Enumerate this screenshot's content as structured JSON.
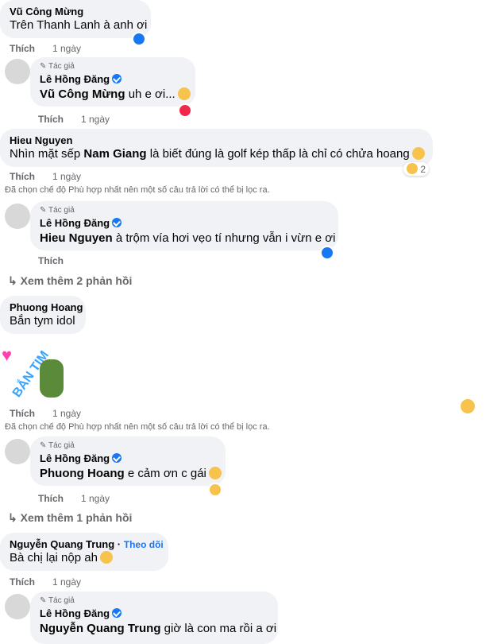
{
  "like_label": "Thích",
  "filter_note": "Đã chọn chế độ Phù hợp nhất nên một số câu trả lời có thể bị lọc ra.",
  "author_badge": "Tác giả",
  "comments": [
    {
      "name": "Vũ Công Mừng",
      "text": "Trên Thanh Lanh à anh ơi",
      "time": "1 ngày"
    },
    {
      "name": "Lê Hồng Đăng",
      "mention": "Vũ Công Mừng",
      "text": "uh e ơi...",
      "time": "1 ngày"
    },
    {
      "name": "Hieu Nguyen",
      "text_pre": "Nhìn mặt sếp",
      "mention": "Nam Giang",
      "text_post": "là biết đúng là golf kép thấp là chỉ có chửa hoang",
      "time": "1 ngày",
      "reaction_count": "2"
    },
    {
      "name": "Lê Hồng Đăng",
      "mention": "Hieu Nguyen",
      "text": "à trộm vía hơi vẹo tí nhưng vẫn i vừn e ơi",
      "time": ""
    },
    {
      "name": "Phuong Hoang",
      "text": "Bắn tym idol",
      "time": "1 ngày",
      "sticker": "BẮN TIM"
    },
    {
      "name": "Lê Hồng Đăng",
      "mention": "Phuong Hoang",
      "text": "e cảm ơn c gái",
      "time": "1 ngày"
    },
    {
      "name": "Nguyễn Quang Trung",
      "follow": "Theo dõi",
      "text": "Bà chị lại nộp ah",
      "time": "1 ngày"
    },
    {
      "name": "Lê Hồng Đăng",
      "mention": "Nguyễn Quang Trung",
      "text": "giờ là con ma rồi a ơi"
    }
  ],
  "more_replies": [
    "Xem thêm 2 phản hồi",
    "Xem thêm 1 phản hồi"
  ],
  "colors": {
    "bubble": "#f0f2f5",
    "meta": "#65676b",
    "link": "#1877f2",
    "like": "#1877f2",
    "love": "#f02849"
  }
}
